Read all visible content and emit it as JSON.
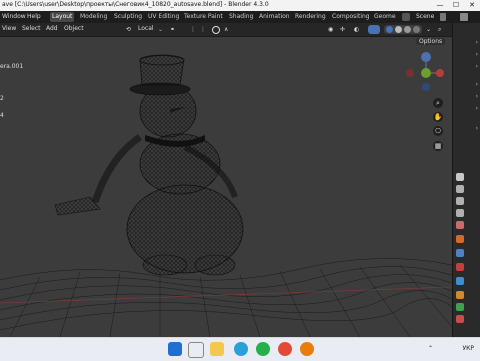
{
  "titlebar": {
    "title": "ave [C:\\Users\\user\\Desktop\\проекты\\Снеговик4_10820_autosave.blend] - Blender 4.3.0",
    "minimize": "—",
    "maximize": "☐",
    "close": "✕"
  },
  "topbar": {
    "menus": [
      "Window",
      "Help"
    ],
    "workspaces": [
      "Layout",
      "Modeling",
      "Sculpting",
      "UV Editing",
      "Texture Paint",
      "Shading",
      "Animation",
      "Rendering",
      "Compositing",
      "Geome"
    ],
    "scene_label": "Scene"
  },
  "header": {
    "menus": [
      "View",
      "Select",
      "Add",
      "Object"
    ],
    "transform_orientation": "Local",
    "options_label": "Options"
  },
  "viewport": {
    "outliner_items": [
      "era.001",
      "2",
      "4"
    ]
  },
  "taskbar": {
    "tray_lang": "УКР"
  },
  "colors": {
    "accent": "#4772b3",
    "viewport_bg": "#3c3c3c",
    "wire": "#0a0a0a"
  }
}
